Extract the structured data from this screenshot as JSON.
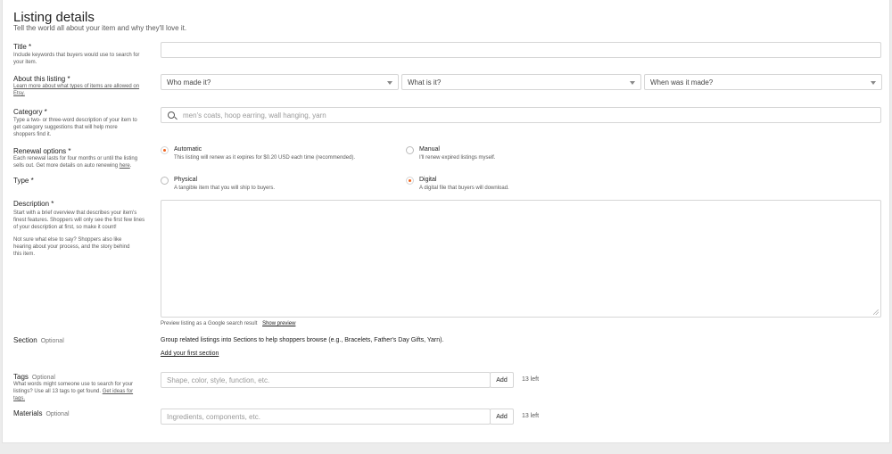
{
  "header": {
    "title": "Listing details",
    "subtitle": "Tell the world all about your item and why they'll love it."
  },
  "title_field": {
    "label": "Title *",
    "help": "Include keywords that buyers would use to search for your item."
  },
  "about": {
    "label": "About this listing *",
    "help_link": "Learn more about what types of items are allowed on Etsy.",
    "who_made": "Who made it?",
    "what_is": "What is it?",
    "when_made": "When was it made?"
  },
  "category": {
    "label": "Category *",
    "help": "Type a two- or three-word description of your item to get category suggestions that will help more shoppers find it.",
    "placeholder": "men's coats, hoop earring, wall hanging, yarn"
  },
  "renewal": {
    "label": "Renewal options *",
    "help_prefix": "Each renewal lasts for four months or until the listing sells out. Get more details on auto renewing ",
    "help_link": "here",
    "automatic_title": "Automatic",
    "automatic_desc": "This listing will renew as it expires for $0.20 USD each time (recommended).",
    "manual_title": "Manual",
    "manual_desc": "I'll renew expired listings myself.",
    "selected": "Automatic"
  },
  "type": {
    "label": "Type *",
    "physical_title": "Physical",
    "physical_desc": "A tangible item that you will ship to buyers.",
    "digital_title": "Digital",
    "digital_desc": "A digital file that buyers will download.",
    "selected": "Digital"
  },
  "description": {
    "label": "Description *",
    "help1": "Start with a brief overview that describes your item's finest features. Shoppers will only see the first few lines of your description at first, so make it count!",
    "help2": "Not sure what else to say? Shoppers also like hearing about your process, and the story behind this item.",
    "preview_text": "Preview listing as a Google search result",
    "preview_link": "Show preview"
  },
  "section": {
    "label": "Section",
    "optional": "Optional",
    "text": "Group related listings into Sections to help shoppers browse (e.g., Bracelets, Father's Day Gifts, Yarn).",
    "link": "Add your first section"
  },
  "tags": {
    "label": "Tags",
    "optional": "Optional",
    "help_prefix": "What words might someone use to search for your listings? Use all 13 tags to get found. ",
    "help_link": "Get ideas for tags.",
    "placeholder": "Shape, color, style, function, etc.",
    "add": "Add",
    "left": "13 left"
  },
  "materials": {
    "label": "Materials",
    "optional": "Optional",
    "placeholder": "Ingredients, components, etc.",
    "add": "Add",
    "left": "13 left"
  },
  "colors": {
    "accent": "#f1641e",
    "border": "#d6d6d6"
  }
}
